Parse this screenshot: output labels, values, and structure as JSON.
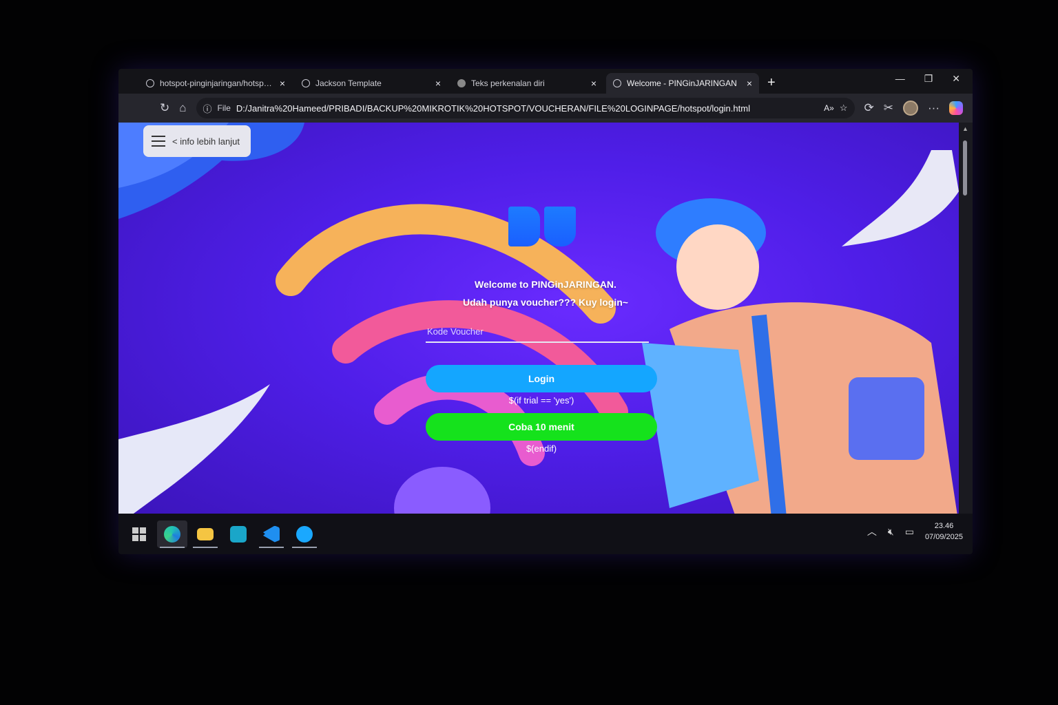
{
  "browser": {
    "tabs": [
      {
        "label": "hotspot-pinginjaringan/hotspot/l",
        "active": false
      },
      {
        "label": "Jackson Template",
        "active": false
      },
      {
        "label": "Teks perkenalan diri",
        "active": false
      },
      {
        "label": "Welcome - PINGinJARINGAN",
        "active": true
      }
    ],
    "close_glyph": "×",
    "new_tab": "+",
    "address": {
      "scheme_label": "File",
      "url": "D:/Janitra%20Hameed/PRIBADI/BACKUP%20MIKROTIK%20HOTSPOT/VOUCHERAN/FILE%20LOGINPAGE/hotspot/login.html"
    }
  },
  "page": {
    "menu_label": "< info lebih lanjut",
    "welcome_line1": "Welcome to PINGinJARINGAN.",
    "welcome_line2": "Udah punya voucher??? Kuy login~",
    "voucher_placeholder": "Kode Voucher",
    "login_label": "Login",
    "trial_condition": "$(if trial == 'yes')",
    "trial_label": "Coba 10 menit",
    "trial_endif": "$(endif)"
  },
  "taskbar": {
    "time": "23.46",
    "date": "07/09/2025"
  },
  "colors": {
    "page_bg": "#4f1ee8",
    "login_button": "#14a6ff",
    "trial_button": "#15e21c",
    "logo": "#1d7bff"
  },
  "icons": [
    "refresh-icon",
    "home-icon",
    "info-icon",
    "read-aloud-icon",
    "favorite-icon",
    "extensions-icon",
    "collections-icon",
    "more-icon",
    "windows-icon",
    "edge-icon",
    "file-explorer-icon",
    "app-icon",
    "vscode-icon",
    "app-icon-2"
  ]
}
